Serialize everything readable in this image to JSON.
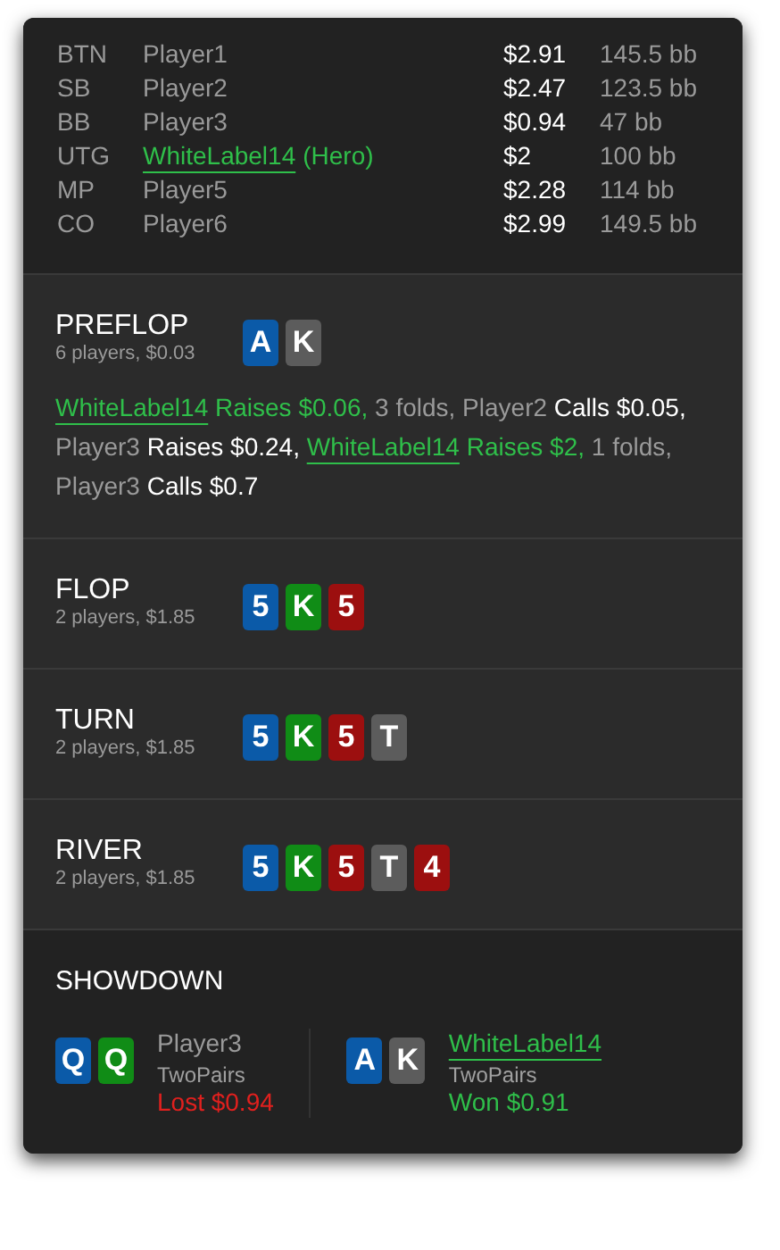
{
  "seats": [
    {
      "position": "BTN",
      "name": "Player1",
      "hero": false,
      "stack": "$2.91",
      "bb": "145.5 bb"
    },
    {
      "position": "SB",
      "name": "Player2",
      "hero": false,
      "stack": "$2.47",
      "bb": "123.5 bb"
    },
    {
      "position": "BB",
      "name": "Player3",
      "hero": false,
      "stack": "$0.94",
      "bb": "47 bb"
    },
    {
      "position": "UTG",
      "name": "WhiteLabel14",
      "hero": true,
      "tag": "(Hero)",
      "stack": "$2",
      "bb": "100 bb"
    },
    {
      "position": "MP",
      "name": "Player5",
      "hero": false,
      "stack": "$2.28",
      "bb": "114 bb"
    },
    {
      "position": "CO",
      "name": "Player6",
      "hero": false,
      "stack": "$2.99",
      "bb": "149.5 bb"
    }
  ],
  "streets": [
    {
      "name": "PREFLOP",
      "info": "6 players, $0.03",
      "cards": [
        {
          "rank": "A",
          "color": "#0b5aa8"
        },
        {
          "rank": "K",
          "color": "#5c5c5c"
        }
      ],
      "actions": [
        {
          "kind": "link",
          "text": "WhiteLabel14"
        },
        {
          "kind": "hero",
          "text": " Raises $0.06,"
        },
        {
          "kind": "muted",
          "text": " 3 folds, Player2"
        },
        {
          "kind": "action",
          "text": " Calls $0.05,"
        },
        {
          "kind": "muted",
          "text": " Player3"
        },
        {
          "kind": "action",
          "text": " Raises $0.24, "
        },
        {
          "kind": "link",
          "text": "WhiteLabel14"
        },
        {
          "kind": "hero",
          "text": " Raises $2,"
        },
        {
          "kind": "muted",
          "text": " 1 folds, Player3"
        },
        {
          "kind": "action",
          "text": " Calls $0.7"
        }
      ]
    },
    {
      "name": "FLOP",
      "info": "2 players, $1.85",
      "cards": [
        {
          "rank": "5",
          "color": "#0b5aa8"
        },
        {
          "rank": "K",
          "color": "#108c16"
        },
        {
          "rank": "5",
          "color": "#9c0f0f"
        }
      ]
    },
    {
      "name": "TURN",
      "info": "2 players, $1.85",
      "cards": [
        {
          "rank": "5",
          "color": "#0b5aa8"
        },
        {
          "rank": "K",
          "color": "#108c16"
        },
        {
          "rank": "5",
          "color": "#9c0f0f"
        },
        {
          "rank": "T",
          "color": "#5c5c5c"
        }
      ]
    },
    {
      "name": "RIVER",
      "info": "2 players, $1.85",
      "cards": [
        {
          "rank": "5",
          "color": "#0b5aa8"
        },
        {
          "rank": "K",
          "color": "#108c16"
        },
        {
          "rank": "5",
          "color": "#9c0f0f"
        },
        {
          "rank": "T",
          "color": "#5c5c5c"
        },
        {
          "rank": "4",
          "color": "#9c0f0f"
        }
      ]
    }
  ],
  "showdown": {
    "title": "SHOWDOWN",
    "hands": [
      {
        "cards": [
          {
            "rank": "Q",
            "color": "#0b5aa8"
          },
          {
            "rank": "Q",
            "color": "#108c16"
          }
        ],
        "player": "Player3",
        "hero": false,
        "hand": "TwoPairs",
        "result": "Lost $0.94",
        "won": false
      },
      {
        "cards": [
          {
            "rank": "A",
            "color": "#0b5aa8"
          },
          {
            "rank": "K",
            "color": "#5c5c5c"
          }
        ],
        "player": "WhiteLabel14",
        "hero": true,
        "hand": "TwoPairs",
        "result": "Won $0.91",
        "won": true
      }
    ]
  }
}
